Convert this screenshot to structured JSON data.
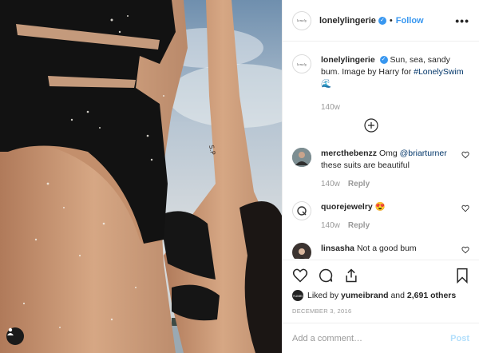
{
  "post": {
    "author": "lonelylingerie",
    "author_avatar_text": "lonely",
    "follow_label": "Follow",
    "dot": "•",
    "more_label": "•••",
    "verified_glyph": "✓"
  },
  "caption": {
    "username": "lonelylingerie",
    "text": "Sun, sea, sandy bum. Image by Harry for ",
    "hashtag": "#LonelySwim",
    "emoji": "🌊",
    "time": "140w"
  },
  "comments": [
    {
      "username": "mercthebenzz",
      "text_prefix": "Omg ",
      "mention": "@briarturner",
      "text_suffix": " these suits are beautiful",
      "time": "140w",
      "reply": "Reply"
    },
    {
      "username": "quorejewelry",
      "text": "😍",
      "time": "140w",
      "reply": "Reply"
    },
    {
      "username": "linsasha",
      "text": "Not a good bum"
    }
  ],
  "likes": {
    "prefix": "Liked by",
    "liker": "yumeibrand",
    "joiner": "and",
    "count": "2,691 others",
    "liker_avatar_text": "YUMEI"
  },
  "date": "DECEMBER 3, 2016",
  "comment_input": {
    "placeholder": "Add a comment…"
  },
  "post_button": "Post",
  "colors": {
    "accent": "#3897f0",
    "link": "#003569",
    "muted": "#999999"
  }
}
